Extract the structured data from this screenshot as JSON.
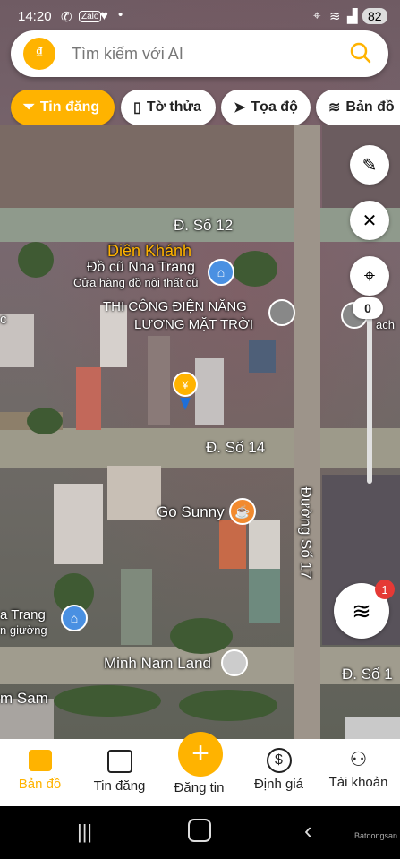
{
  "status": {
    "time": "14:20",
    "battery": "82",
    "left_icons": [
      "phone-icon",
      "zalo-icon",
      "heart-icon",
      "dot-icon"
    ],
    "right_icons": [
      "location-icon",
      "wifi-icon",
      "signal-icon"
    ]
  },
  "search": {
    "placeholder": "Tìm kiếm với AI"
  },
  "chips": [
    {
      "label": "Tin đăng",
      "icon": "filter-icon",
      "active": true
    },
    {
      "label": "Tờ thửa",
      "icon": "map-icon",
      "active": false
    },
    {
      "label": "Tọa độ",
      "icon": "navigation-icon",
      "active": false
    },
    {
      "label": "Bản đồ",
      "icon": "layers-icon",
      "active": false
    }
  ],
  "map": {
    "streets": {
      "so12": "Đ. Số 12",
      "so14": "Đ. Số 14",
      "so17": "Đường Số 17",
      "so1": "Đ. Số 1"
    },
    "labels": {
      "dien_khanh": "Diên Khánh",
      "do_cu_1": "Đồ cũ Nha Trang",
      "do_cu_2": "Cửa hàng đồ nội thất cũ",
      "thi_cong_1": "THI CÔNG ĐIỆN NĂNG",
      "thi_cong_2": "LƯƠNG MẶT TRỜI",
      "go_sunny": "Go Sunny",
      "minh_nam": "Minh Nam Land",
      "nha_trang": "a Trang",
      "giuong": "n giường",
      "m_sam": "m Sam",
      "c_left": "c",
      "ach_right": "ach"
    },
    "slider_value": "0",
    "layers_badge": "1"
  },
  "nav": [
    {
      "label": "Bản đồ",
      "icon": "map-columns-icon",
      "active": true
    },
    {
      "label": "Tin đăng",
      "icon": "list-icon",
      "active": false
    },
    {
      "label": "Đăng tin",
      "icon": "plus-icon",
      "active": false
    },
    {
      "label": "Định giá",
      "icon": "dollar-icon",
      "active": false
    },
    {
      "label": "Tài khoản",
      "icon": "user-icon",
      "active": false
    }
  ],
  "watermark": "Batdongsan",
  "colors": {
    "accent": "#FFB300",
    "text": "#222222",
    "badge": "#E53935"
  }
}
